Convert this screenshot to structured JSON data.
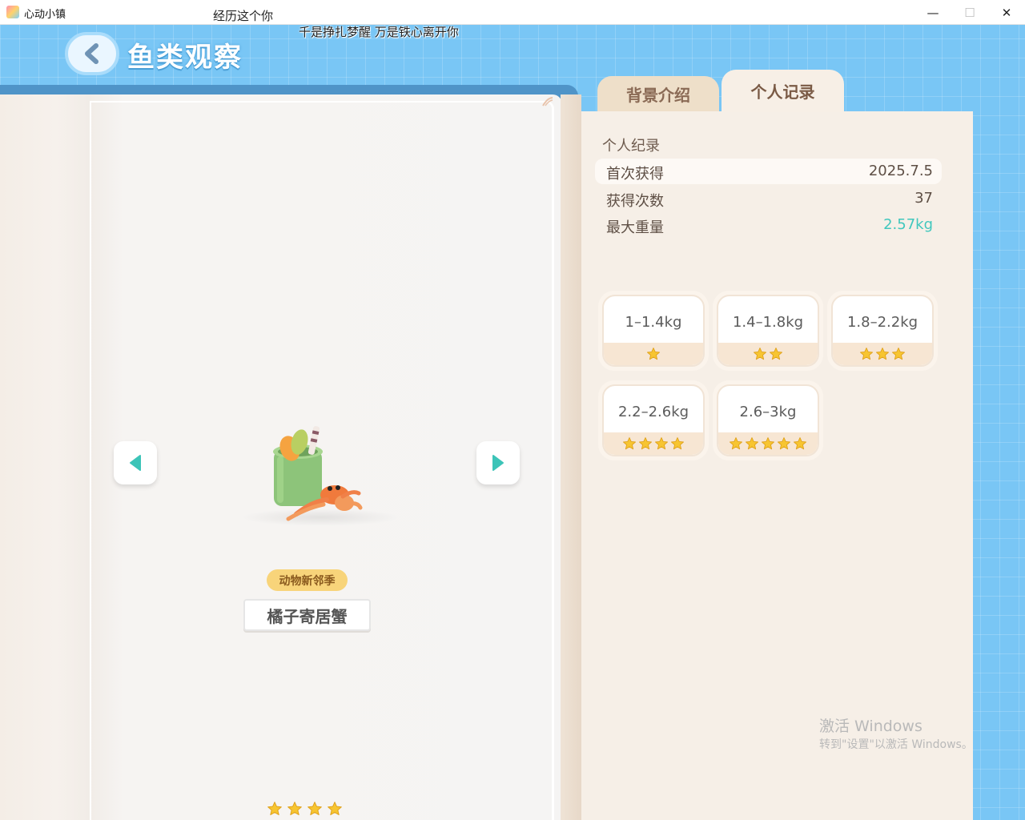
{
  "window": {
    "title": "心动小镇",
    "minimize_glyph": "—",
    "maximize_glyph": "☐",
    "close_glyph": "✕"
  },
  "overlay_lyrics": {
    "line1": "经历这个你",
    "line2": "千是挣扎梦醒 万是铁心离开你"
  },
  "header": {
    "back_icon": "chevron-left-icon",
    "title": "鱼类观察"
  },
  "tabs": [
    {
      "label": "背景介绍",
      "active": false
    },
    {
      "label": "个人记录",
      "active": true
    }
  ],
  "creature": {
    "season_badge": "动物新邻季",
    "name": "橘子寄居蟹",
    "star_rating": 4,
    "max_stars": 4
  },
  "records": {
    "section_title": "个人纪录",
    "rows": [
      {
        "label": "首次获得",
        "value": "2025.7.5"
      },
      {
        "label": "获得次数",
        "value": "37"
      },
      {
        "label": "最大重量",
        "value": "2.57kg"
      }
    ]
  },
  "weight_tiers": [
    {
      "range": "1–1.4kg",
      "stars": 1
    },
    {
      "range": "1.4–1.8kg",
      "stars": 2
    },
    {
      "range": "1.8–2.2kg",
      "stars": 3
    },
    {
      "range": "2.2–2.6kg",
      "stars": 4
    },
    {
      "range": "2.6–3kg",
      "stars": 5
    }
  ],
  "watermark": {
    "title": "激活 Windows",
    "subtitle": "转到\"设置\"以激活 Windows。"
  },
  "colors": {
    "background_blue": "#79c6f5",
    "panel_cream": "#f6efe7",
    "accent_teal": "#40c7bd",
    "star_gold": "#f7c531",
    "badge_yellow": "#f8d47a"
  }
}
